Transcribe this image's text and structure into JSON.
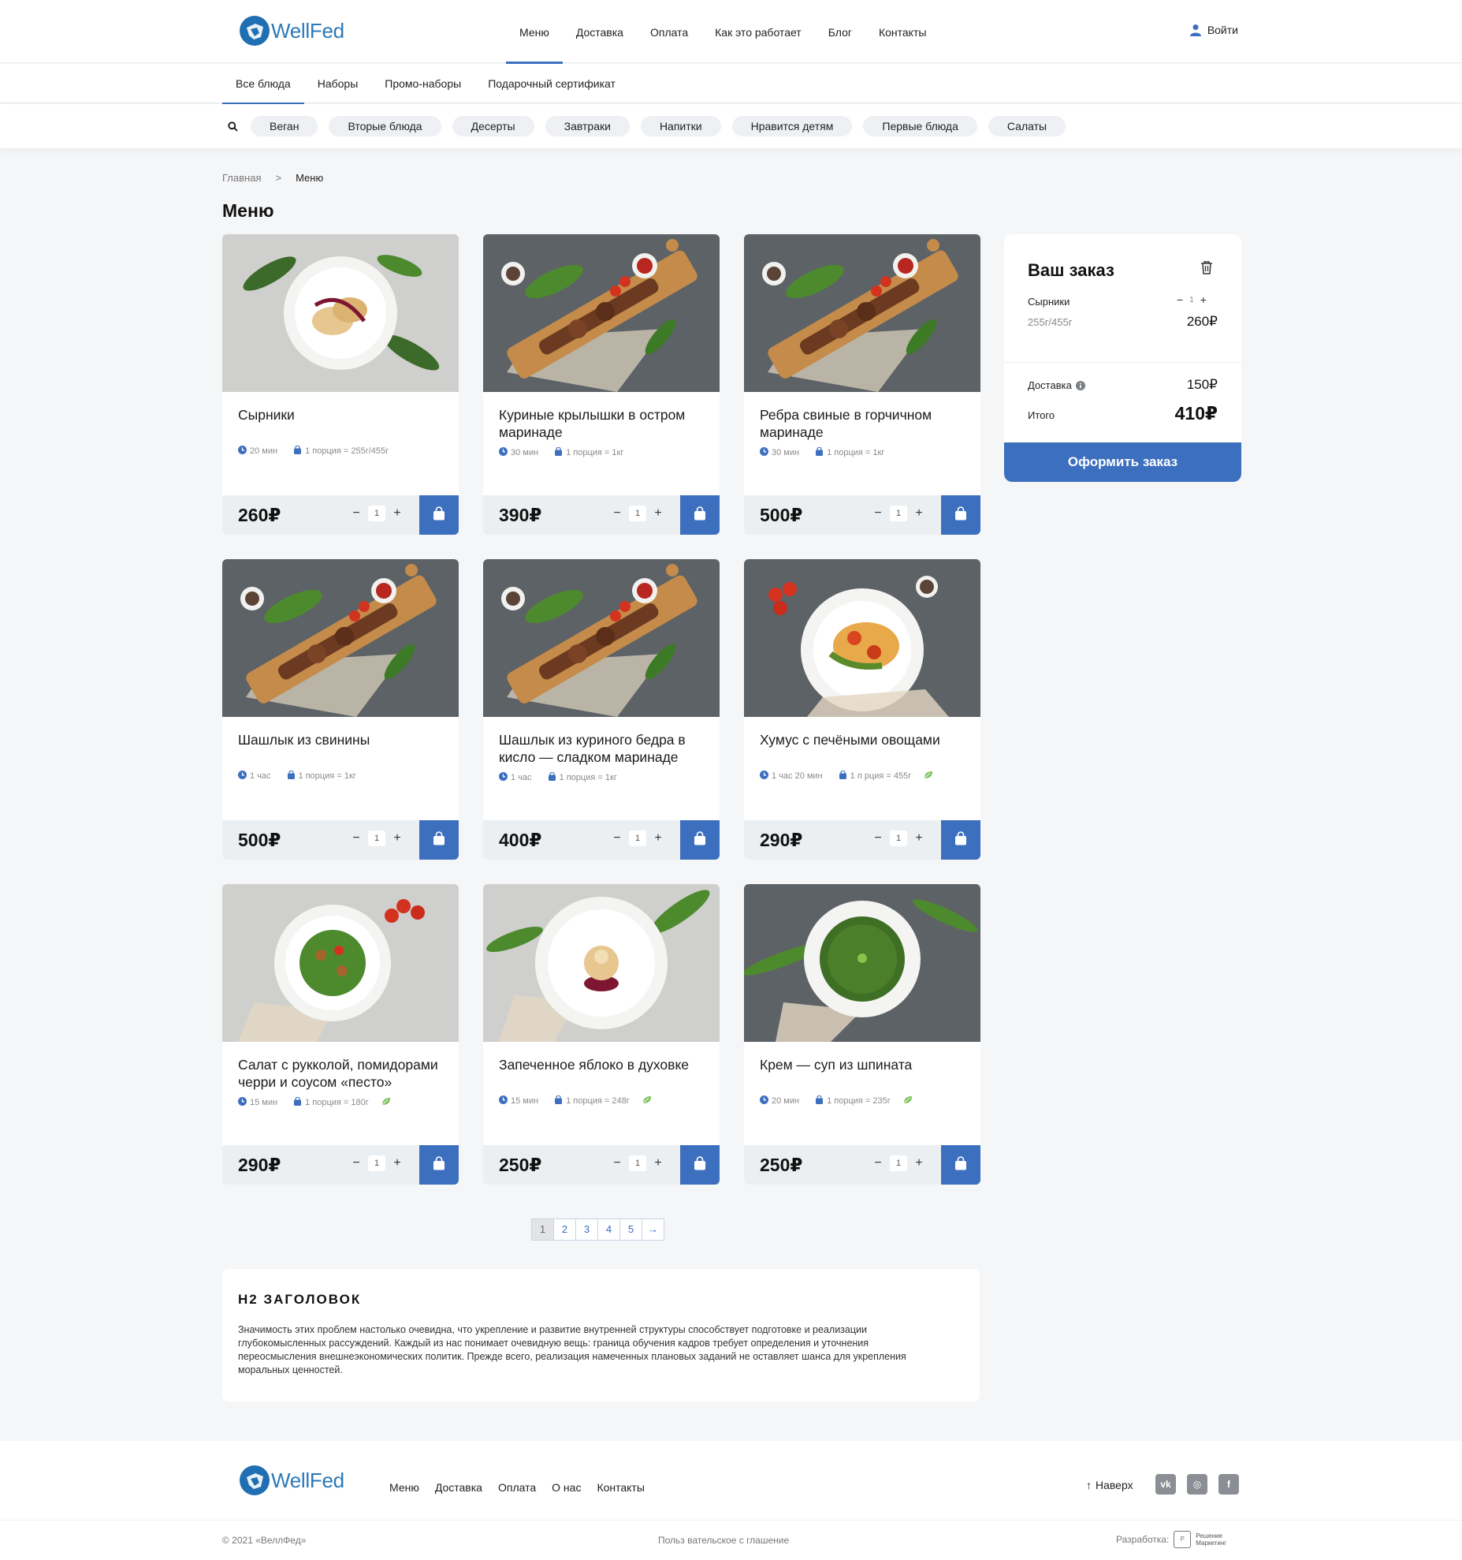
{
  "brand": {
    "name": "WellFed",
    "accent": "#3d6fbf",
    "logo_color": "#1f6fb2"
  },
  "header": {
    "nav": [
      "Меню",
      "Доставка",
      "Оплата",
      "Как это работает",
      "Блог",
      "Контакты"
    ],
    "active_nav": "Меню",
    "login": "Войти"
  },
  "subnav": {
    "tabs": [
      "Все блюда",
      "Наборы",
      "Промо-наборы",
      "Подарочный сертификат"
    ],
    "active_tab": "Все блюда"
  },
  "filters": [
    "Веган",
    "Вторые блюда",
    "Десерты",
    "Завтраки",
    "Напитки",
    "Нравится детям",
    "Первые блюда",
    "Салаты"
  ],
  "breadcrumb": {
    "home": "Главная",
    "separator": ">",
    "current": "Меню"
  },
  "page_title": "Меню",
  "products": [
    {
      "name": "Сырники",
      "time": "20 мин",
      "portion": "1 порция = 255г/455г",
      "vegan": false,
      "price": "260₽",
      "qty": "1",
      "photo": "syrniki"
    },
    {
      "name": "Куриные крылышки в остром маринаде",
      "time": "30 мин",
      "portion": "1 порция = 1кг",
      "vegan": false,
      "price": "390₽",
      "qty": "1",
      "photo": "board"
    },
    {
      "name": "Ребра свиные в горчичном маринаде",
      "time": "30 мин",
      "portion": "1 порция = 1кг",
      "vegan": false,
      "price": "500₽",
      "qty": "1",
      "photo": "board"
    },
    {
      "name": "Шашлык из свинины",
      "time": "1 час",
      "portion": "1 порция = 1кг",
      "vegan": false,
      "price": "500₽",
      "qty": "1",
      "photo": "board"
    },
    {
      "name": "Шашлык из куриного бедра в кисло — сладком маринаде",
      "time": "1 час",
      "portion": "1 порция = 1кг",
      "vegan": false,
      "price": "400₽",
      "qty": "1",
      "photo": "board"
    },
    {
      "name": "Хумус с печёными овощами",
      "time": "1 час 20 мин",
      "portion": "1 п рция = 455г",
      "vegan": true,
      "price": "290₽",
      "qty": "1",
      "photo": "hummus"
    },
    {
      "name": "Салат с рукколой, помидорами черри и соусом «песто»",
      "time": "15 мин",
      "portion": "1 порция = 180г",
      "vegan": true,
      "price": "290₽",
      "qty": "1",
      "photo": "salad"
    },
    {
      "name": "Запеченное яблоко в духовке",
      "time": "15 мин",
      "portion": "1 порция = 248г",
      "vegan": true,
      "price": "250₽",
      "qty": "1",
      "photo": "apple"
    },
    {
      "name": "Крем — суп из шпината",
      "time": "20 мин",
      "portion": "1 порция = 235г",
      "vegan": true,
      "price": "250₽",
      "qty": "1",
      "photo": "soup"
    }
  ],
  "order": {
    "title": "Ваш заказ",
    "item_name": "Сырники",
    "item_weight": "255г/455г",
    "item_qty": "1",
    "item_price": "260₽",
    "delivery_label": "Доставка",
    "delivery_value": "150₽",
    "total_label": "Итого",
    "total_value": "410₽",
    "checkout": "Оформить заказ"
  },
  "pagination": {
    "pages": [
      "1",
      "2",
      "3",
      "4",
      "5"
    ],
    "active": "1",
    "next": "→"
  },
  "seo": {
    "heading": "H2 ЗАГОЛОВОК",
    "text": "Значимость этих проблем настолько очевидна, что укрепление и развитие внутренней структуры способствует подготовке и реализации глубокомысленных рассуждений. Каждый из нас понимает очевидную вещь: граница обучения кадров требует определения и уточнения переосмысления внешнеэкономических политик. Прежде всего, реализация намеченных плановых заданий не оставляет шанса для укрепления моральных ценностей."
  },
  "footer": {
    "links": [
      "Меню",
      "Доставка",
      "Оплата",
      "О нас",
      "Контакты"
    ],
    "up": "Наверх",
    "social": [
      {
        "name": "vk",
        "glyph": "vk"
      },
      {
        "name": "instagram",
        "glyph": "◎"
      },
      {
        "name": "facebook",
        "glyph": "f"
      }
    ],
    "copyright": "© 2021 «ВеллФед»",
    "terms": "Польз вательское с глашение",
    "dev_label": "Разработка:",
    "dev_company": "Решение Маркетинг"
  }
}
